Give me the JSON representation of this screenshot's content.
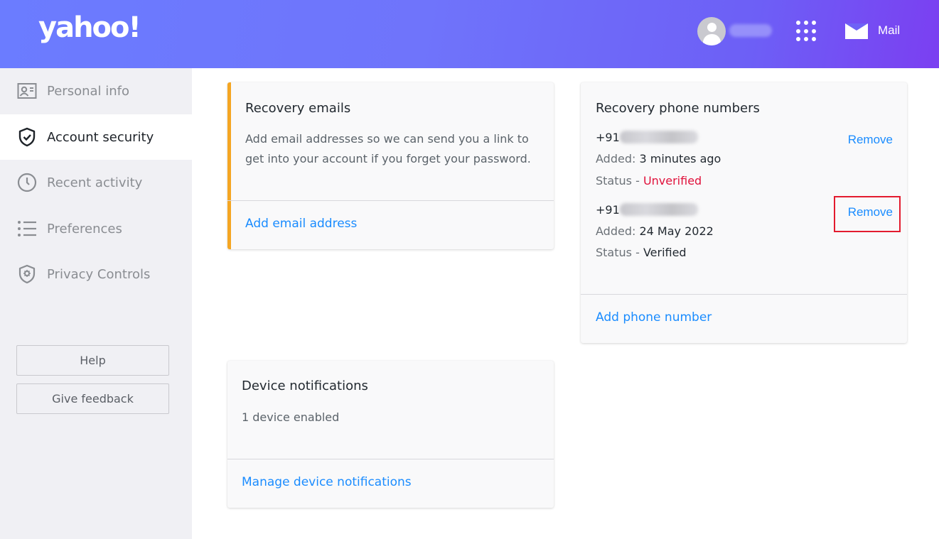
{
  "header": {
    "logo": "yahoo!",
    "username_blurred": true,
    "apps_icon": "grid-icon",
    "mail_label": "Mail",
    "colors": {
      "gradient_start": "#6b7cff",
      "gradient_end": "#7b3ff1"
    }
  },
  "sidebar": {
    "items": [
      {
        "label": "Personal info",
        "icon": "id-card-icon",
        "active": false
      },
      {
        "label": "Account security",
        "icon": "shield-check-icon",
        "active": true
      },
      {
        "label": "Recent activity",
        "icon": "clock-icon",
        "active": false
      },
      {
        "label": "Preferences",
        "icon": "list-icon",
        "active": false
      },
      {
        "label": "Privacy Controls",
        "icon": "shield-gear-icon",
        "active": false
      }
    ],
    "help_label": "Help",
    "feedback_label": "Give feedback"
  },
  "recovery_emails": {
    "title": "Recovery emails",
    "description": "Add email addresses so we can send you a link to get into your account if you forget your password.",
    "add_link": "Add email address",
    "accent_color": "#f5a623"
  },
  "recovery_phones": {
    "title": "Recovery phone numbers",
    "numbers": [
      {
        "prefix": "+91",
        "added_label": "Added:",
        "added_value": "3 minutes ago",
        "status_label": "Status -",
        "status_value": "Unverified",
        "remove_label": "Remove"
      },
      {
        "prefix": "+91",
        "added_label": "Added:",
        "added_value": "24 May 2022",
        "status_label": "Status -",
        "status_value": "Verified",
        "remove_label": "Remove"
      }
    ],
    "add_link": "Add phone number"
  },
  "device_notifications": {
    "title": "Device notifications",
    "status": "1 device enabled",
    "manage_link": "Manage device notifications"
  },
  "colors": {
    "link": "#1a8cff",
    "unverified": "#e0103a",
    "highlight": "#e31b2e"
  }
}
